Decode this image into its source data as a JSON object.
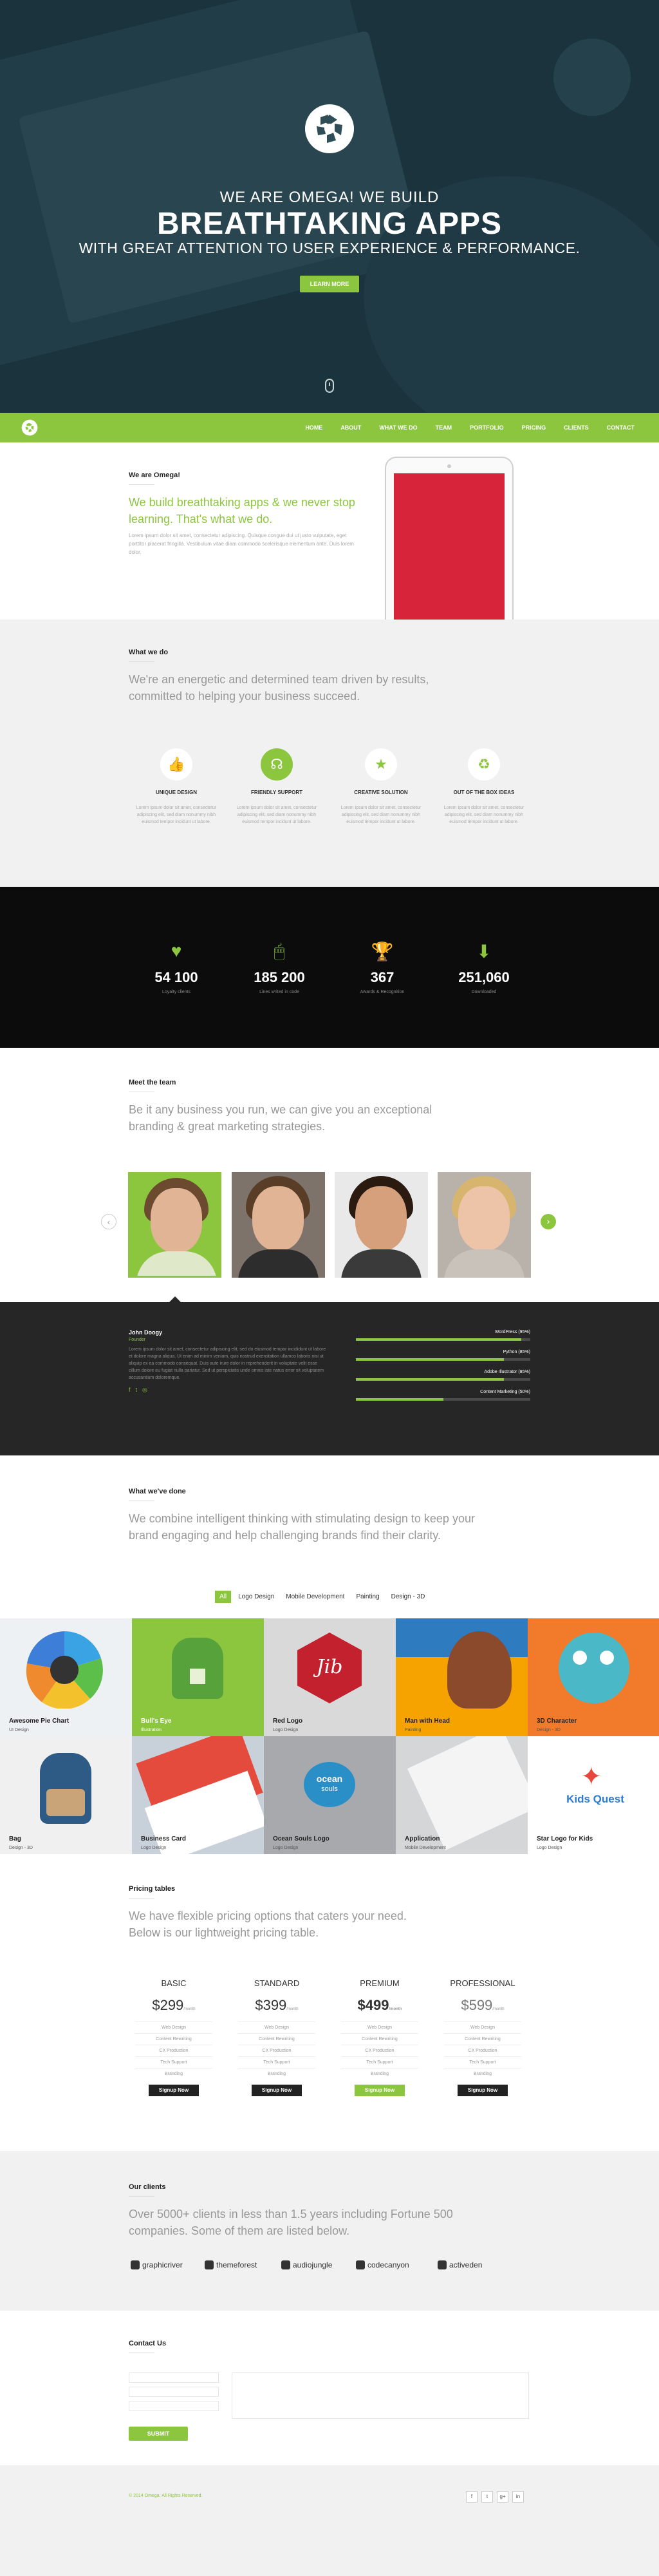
{
  "hero": {
    "line1": "WE ARE OMEGA! WE BUILD",
    "line2": "BREATHTAKING APPS",
    "line3": "WITH GREAT ATTENTION TO USER EXPERIENCE & PERFORMANCE.",
    "button": "LEARN MORE"
  },
  "nav": {
    "items": [
      "HOME",
      "ABOUT",
      "WHAT WE DO",
      "TEAM",
      "PORTFOLIO",
      "PRICING",
      "CLIENTS",
      "CONTACT"
    ]
  },
  "intro": {
    "title": "We are Omega!",
    "lead": "We build breathtaking apps & we never stop learning. That's what we do.",
    "body": "Lorem ipsum dolor sit amet, consectetur adipiscing. Quisque congue dui ut justo vulputate, eget porttitor placerat fringilla. Vestibulum vitae diam commodo scelerisque elementum ante. Duis lorem dolor."
  },
  "wwd": {
    "title": "What we do",
    "lead": "We're an energetic and determined team driven by results, committed to helping your business succeed.",
    "features": [
      {
        "title": "UNIQUE DESIGN",
        "desc": "Lorem ipsum dolor sit amet, consectetur adipiscing elit, sed diam nonummy nibh euismod tempor incidunt ut labore.",
        "icon": "thumbs-up-icon"
      },
      {
        "title": "FRIENDLY SUPPORT",
        "desc": "Lorem ipsum dolor sit amet, consectetur adipiscing elit, sed diam nonummy nibh euismod tempor incidunt ut labore.",
        "icon": "headset-icon"
      },
      {
        "title": "CREATIVE SOLUTION",
        "desc": "Lorem ipsum dolor sit amet, consectetur adipiscing elit, sed diam nonummy nibh euismod tempor incidunt ut labore.",
        "icon": "star-icon"
      },
      {
        "title": "OUT OF THE BOX IDEAS",
        "desc": "Lorem ipsum dolor sit amet, consectetur adipiscing elit, sed diam nonummy nibh euismod tempor incidunt ut labore.",
        "icon": "recycle-icon"
      }
    ]
  },
  "stats": [
    {
      "value": "54 100",
      "label": "Loyalty clients",
      "icon": "heart-icon"
    },
    {
      "value": "185 200",
      "label": "Lines writed in code",
      "icon": "mouse-icon"
    },
    {
      "value": "367",
      "label": "Awards & Recognition",
      "icon": "trophy-icon"
    },
    {
      "value": "251,060",
      "label": "Downloaded",
      "icon": "download-icon"
    }
  ],
  "team": {
    "title": "Meet the team",
    "lead": "Be it any business you run, we can give you an exceptional branding & great marketing strategies.",
    "member_name": "John Doogy",
    "member_role": "Founder",
    "member_bio": "Lorem ipsum dolor sit amet, consectetur adipiscing elit, sed do eiusmod tempor incididunt ut labore et dolore magna aliqua. Ut enim ad minim veniam, quis nostrud exercitation ullamco laboris nisi ut aliquip ex ea commodo consequat. Duis aute irure dolor in reprehenderit in voluptate velit esse cillum dolore eu fugiat nulla pariatur. Sed ut perspiciatis unde omnis iste natus error sit voluptatem accusantium doloremque.",
    "skills": [
      {
        "label": "WordPress (95%)",
        "pct": 95
      },
      {
        "label": "Python (85%)",
        "pct": 85
      },
      {
        "label": "Adobe Illustrator (85%)",
        "pct": 85
      },
      {
        "label": "Content Marketing (50%)",
        "pct": 50
      }
    ]
  },
  "portfolio": {
    "title": "What we've done",
    "lead": "We combine intelligent thinking with stimulating design to keep your brand engaging and help challenging brands find their clarity.",
    "filters": [
      "All",
      "Logo Design",
      "Mobile Development",
      "Painting",
      "Design - 3D"
    ],
    "items": [
      {
        "title": "Awesome Pie Chart",
        "sub": "UI Design",
        "bg": "#eef1f4"
      },
      {
        "title": "Bull's Eye",
        "sub": "Illustration",
        "bg": "#8cc63f"
      },
      {
        "title": "Red Logo",
        "sub": "Logo Design",
        "bg": "#d9d9d9"
      },
      {
        "title": "Man with Head",
        "sub": "Painting",
        "bg": "#f6a300"
      },
      {
        "title": "3D Character",
        "sub": "Design - 3D",
        "bg": "#f27a2b"
      },
      {
        "title": "Bag",
        "sub": "Design - 3D",
        "bg": "#f0f0f0"
      },
      {
        "title": "Business Card",
        "sub": "Logo Design",
        "bg": "#c8d0da"
      },
      {
        "title": "Ocean Souls Logo",
        "sub": "Logo Design",
        "bg": "#a7a9ac"
      },
      {
        "title": "Application",
        "sub": "Mobile Development",
        "bg": "#d5d6d8"
      },
      {
        "title": "Star Logo for Kids",
        "sub": "Logo Design",
        "bg": "#ffffff"
      }
    ],
    "tile_texts": {
      "jib": "Jib",
      "ocean": "ocean",
      "souls": "souls",
      "kids": "Kids Quest"
    }
  },
  "pricing": {
    "title": "Pricing tables",
    "lead": "We have flexible pricing options that caters your need. Below is our lightweight pricing table.",
    "plans": [
      {
        "name": "BASIC",
        "price": "$299",
        "per": "/month",
        "button": "Signup Now"
      },
      {
        "name": "STANDARD",
        "price": "$399",
        "per": "/month",
        "button": "Signup Now"
      },
      {
        "name": "PREMIUM",
        "price": "$499",
        "per": "/month",
        "button": "Signup Now"
      },
      {
        "name": "PROFESSIONAL",
        "price": "$599",
        "per": "/month",
        "button": "Signup Now"
      }
    ],
    "features": [
      "Web Design",
      "Content Rewriting",
      "CX Production",
      "Tech Support",
      "Branding"
    ]
  },
  "clients": {
    "title": "Our clients",
    "lead": "Over 5000+ clients in less than 1.5 years including Fortune 500 companies. Some of them are listed below.",
    "logos": [
      "graphicriver",
      "themeforest",
      "audiojungle",
      "codecanyon",
      "activeden"
    ]
  },
  "contact": {
    "title": "Contact Us",
    "button": "SUBMIT"
  },
  "footer": {
    "copyright": "© 2014 Omega. All Rights Reserved.",
    "social": [
      "f",
      "t",
      "g+",
      "in"
    ]
  },
  "colors": {
    "accent": "#8cc63f",
    "dark": "#0c0c0c",
    "hero": "#1f3a43"
  }
}
